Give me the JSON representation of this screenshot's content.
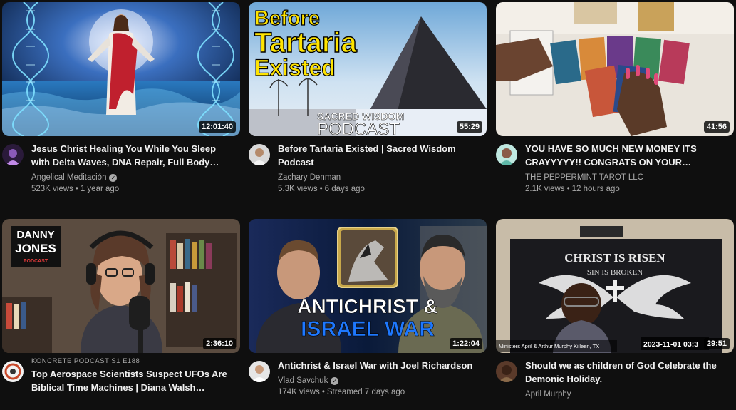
{
  "videos": [
    {
      "title": "Jesus Christ Healing You While You Sleep with Delta Waves, DNA Repair, Full Body…",
      "channel": "Angelical Meditación",
      "verified": true,
      "views": "523K views",
      "age": "1 year ago",
      "duration": "12:01:40"
    },
    {
      "title": "Before Tartaria Existed | Sacred Wisdom Podcast",
      "channel": "Zachary Denman",
      "verified": false,
      "views": "5.3K views",
      "age": "6 days ago",
      "duration": "55:29",
      "thumb_text": {
        "line1": "Before",
        "line2": "Tartaria",
        "line3": "Existed",
        "badge1": "SACRED WISDOM",
        "badge2": "PODCAST"
      }
    },
    {
      "title": "YOU HAVE SO MUCH NEW MONEY ITS CRAYYYYY!! CONGRATS ON YOUR…",
      "channel": "THE PEPPERMINT TAROT LLC",
      "verified": false,
      "views": "2.1K views",
      "age": "12 hours ago",
      "duration": "41:56"
    },
    {
      "overline": "KONCRETE PODCAST  S1 E188",
      "title": "Top Aerospace Scientists Suspect UFOs Are Biblical Time Machines | Diana Walsh…",
      "channel": "",
      "verified": false,
      "views": "",
      "age": "",
      "duration": "2:36:10",
      "thumb_text": {
        "logo1": "DANNY",
        "logo2": "JONES",
        "logo3": "PODCAST"
      }
    },
    {
      "title": "Antichrist & Israel War with Joel Richardson",
      "channel": "Vlad Savchuk",
      "verified": true,
      "views": "174K views",
      "age": "Streamed 7 days ago",
      "duration": "1:22:04",
      "thumb_text": {
        "line1": "ANTICHRIST &",
        "line2": "ISRAEL WAR"
      }
    },
    {
      "title": "Should we as children of God Celebrate the Demonic Holiday.",
      "channel": "April Murphy",
      "verified": false,
      "views": "",
      "age": "",
      "duration": "29:51",
      "thumb_text": {
        "banner1": "CHRIST IS RISEN",
        "banner2": "SIN IS BROKEN",
        "caption": "Ministers April & Arthur Murphy Killeen, TX",
        "timestamp": "2023-11-01  03:3"
      }
    }
  ]
}
